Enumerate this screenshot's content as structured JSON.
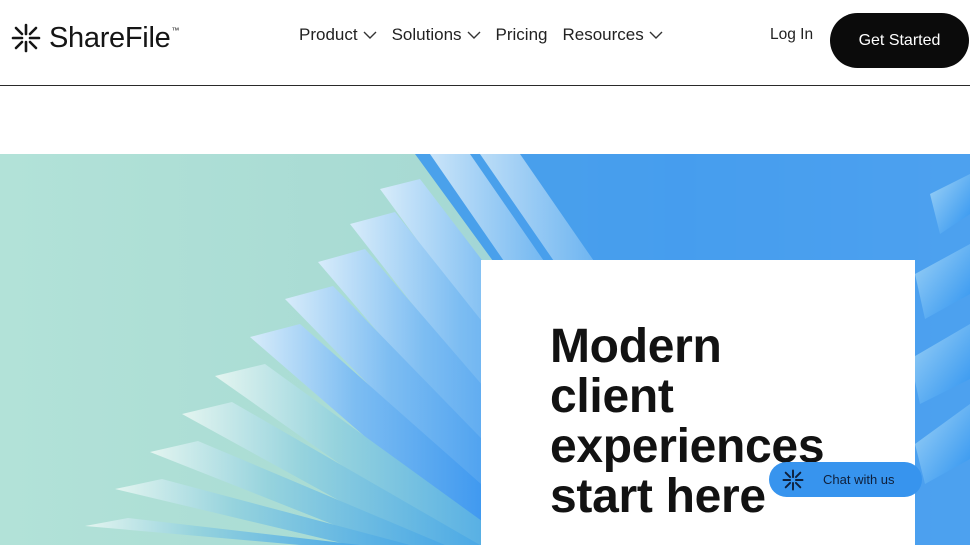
{
  "brand": {
    "name": "ShareFile",
    "trademark": "™"
  },
  "nav": {
    "items": [
      {
        "label": "Product",
        "has_dropdown": true
      },
      {
        "label": "Solutions",
        "has_dropdown": true
      },
      {
        "label": "Pricing",
        "has_dropdown": false
      },
      {
        "label": "Resources",
        "has_dropdown": true
      }
    ],
    "login_label": "Log In",
    "cta_label": "Get Started"
  },
  "hero": {
    "headline_lines": [
      "Modern",
      "client",
      "experiences",
      "start here"
    ],
    "background_image": "abstract-blue-glass-blades"
  },
  "chat": {
    "label": "Chat with us",
    "icon": "sharefile-logo-icon"
  },
  "colors": {
    "cta_background": "#0b0b0b",
    "chat_background": "#3794ee",
    "hero_mint": "#a9dbd2",
    "hero_blue": "#2b8cf0"
  }
}
